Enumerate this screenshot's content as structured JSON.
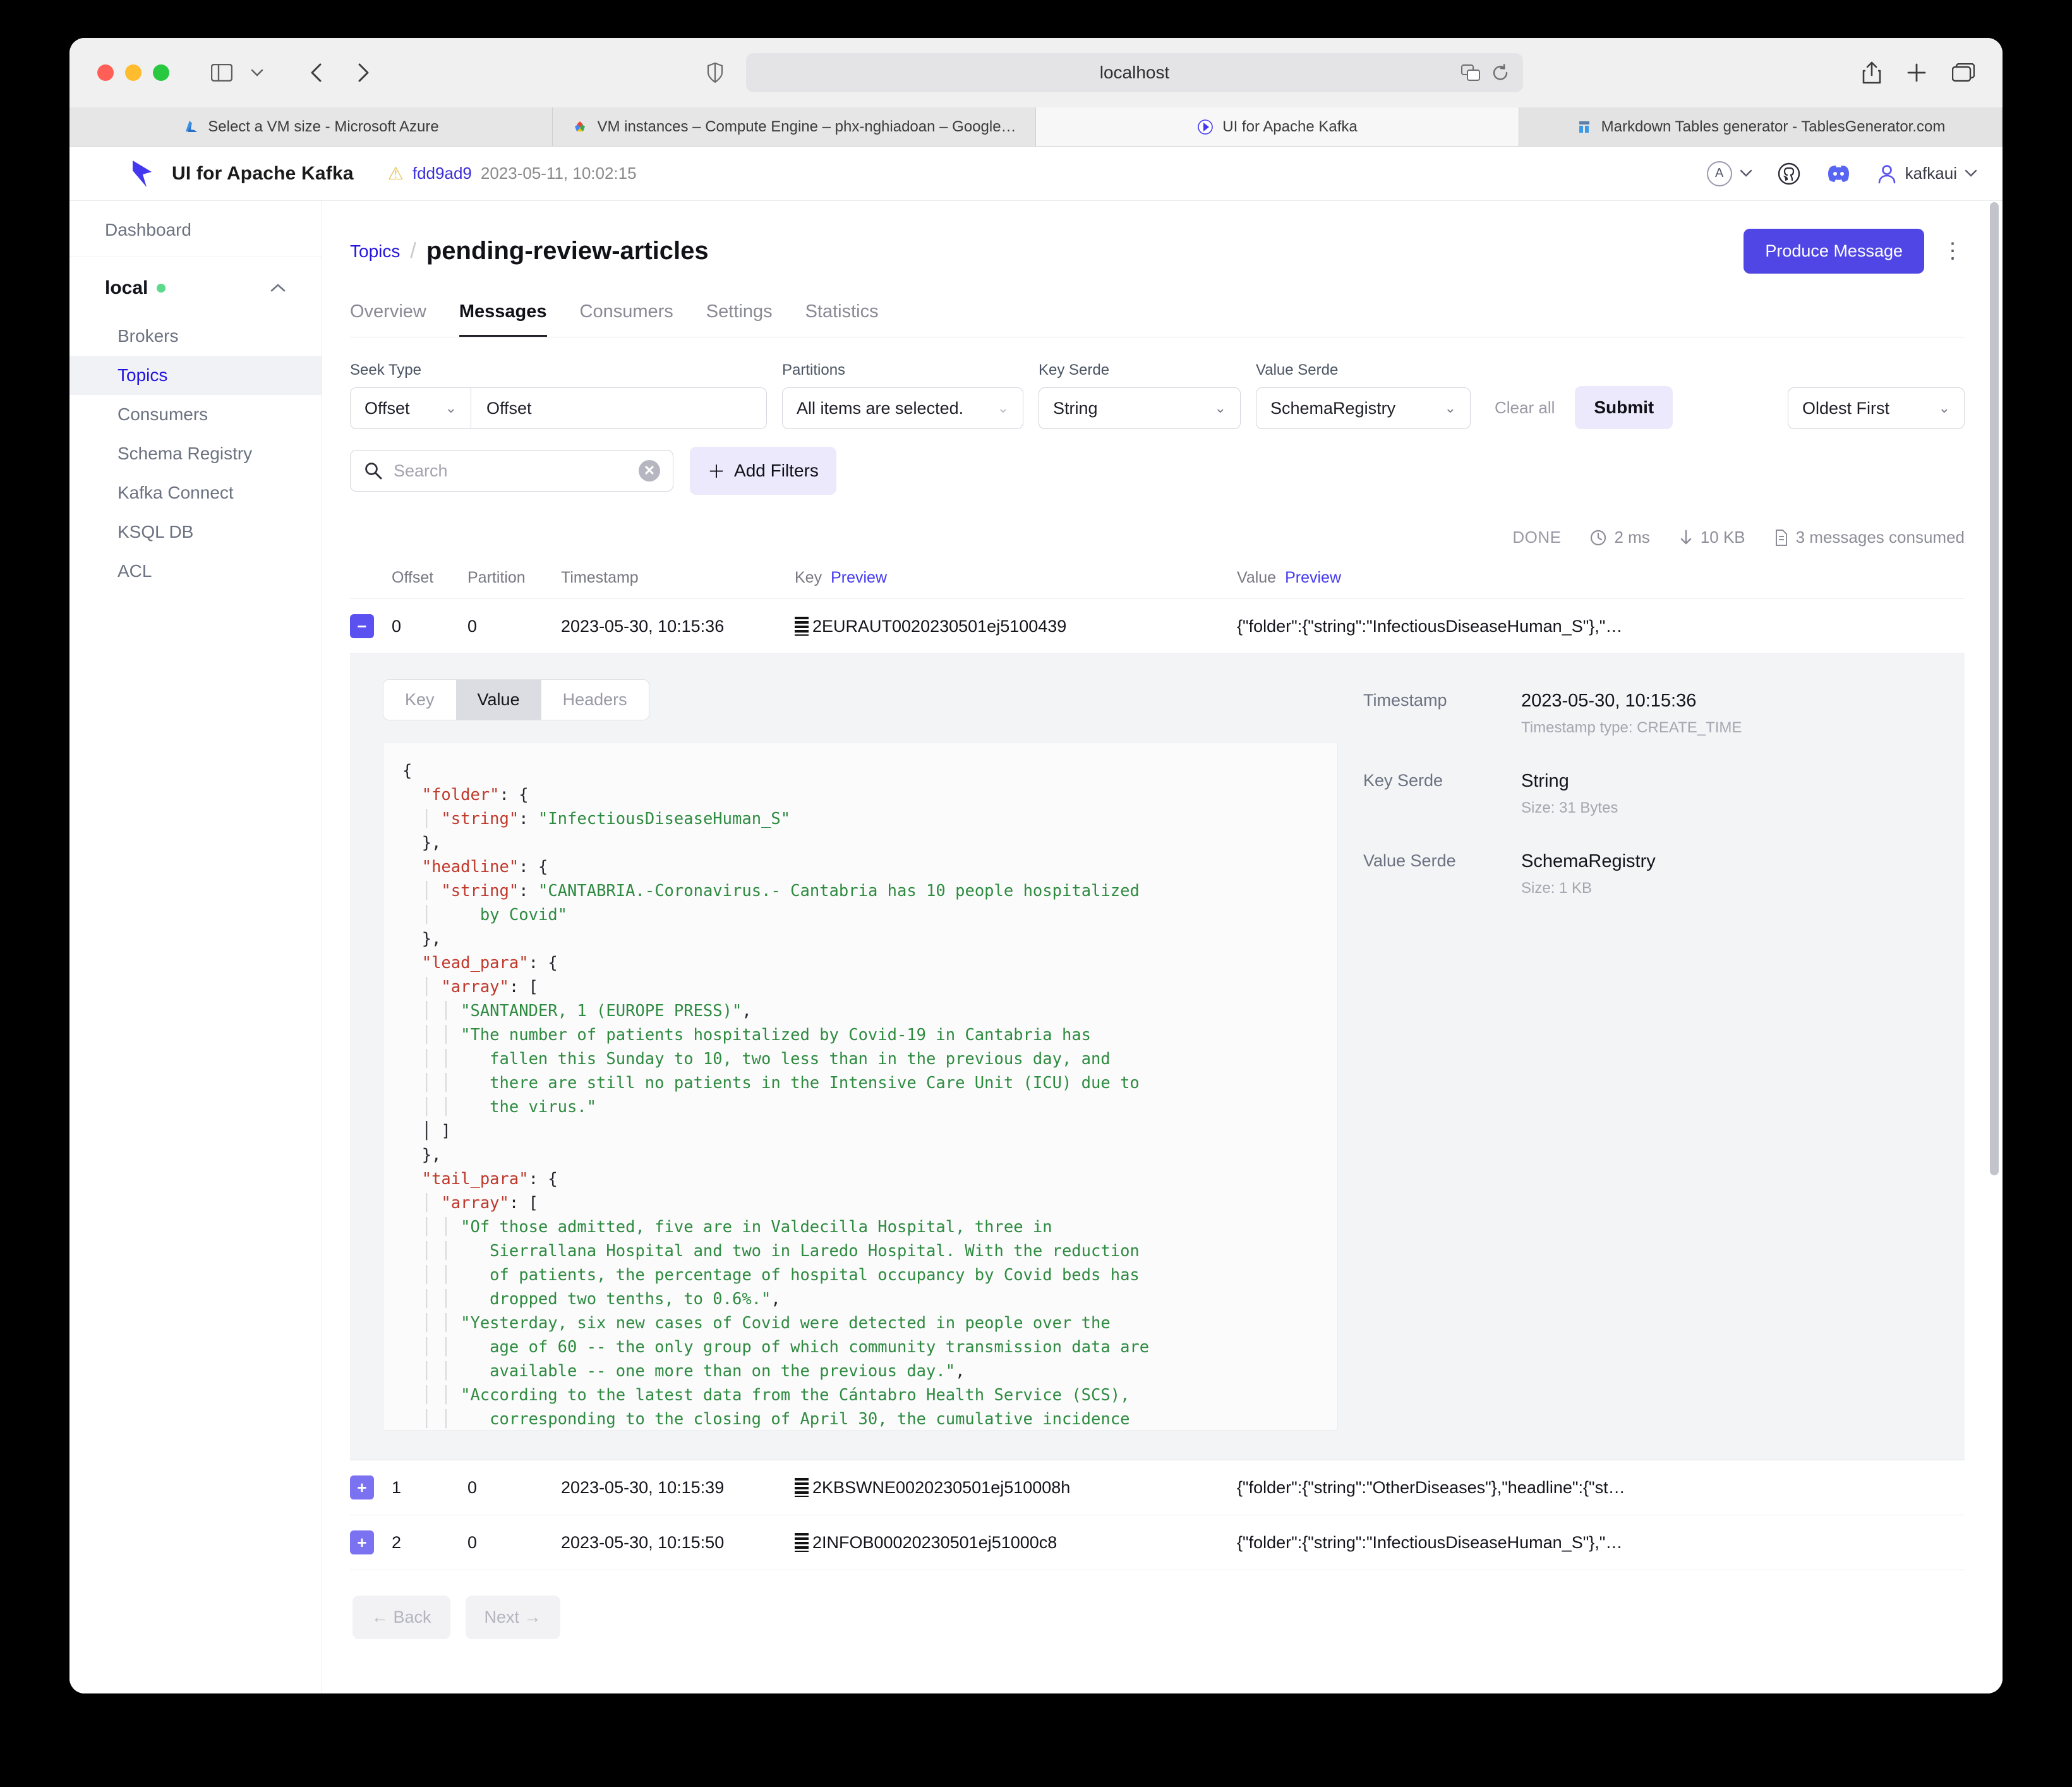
{
  "browser": {
    "url": "localhost",
    "tabs": [
      {
        "label": "Select a VM size - Microsoft Azure",
        "favicon": "azure-icon",
        "state": "inactive"
      },
      {
        "label": "VM instances – Compute Engine – phx-nghiadoan – Google…",
        "favicon": "google-cloud-icon",
        "state": "inactive"
      },
      {
        "label": "UI for Apache Kafka",
        "favicon": "kafka-ui-icon",
        "state": "active"
      },
      {
        "label": "Markdown Tables generator - TablesGenerator.com",
        "favicon": "tablesgenerator-icon",
        "state": "dim"
      }
    ]
  },
  "app_header": {
    "brand": "UI for Apache Kafka",
    "version_hash": "fdd9ad9",
    "version_date": "2023-05-11, 10:02:15",
    "theme_letter": "A",
    "user": "kafkaui"
  },
  "sidebar": {
    "dashboard": "Dashboard",
    "cluster": "local",
    "items": [
      {
        "label": "Brokers",
        "active": false
      },
      {
        "label": "Topics",
        "active": true
      },
      {
        "label": "Consumers",
        "active": false
      },
      {
        "label": "Schema Registry",
        "active": false
      },
      {
        "label": "Kafka Connect",
        "active": false
      },
      {
        "label": "KSQL DB",
        "active": false
      },
      {
        "label": "ACL",
        "active": false
      }
    ]
  },
  "page": {
    "breadcrumb_parent": "Topics",
    "title": "pending-review-articles",
    "produce_button": "Produce Message",
    "tabs": [
      {
        "label": "Overview",
        "selected": false
      },
      {
        "label": "Messages",
        "selected": true
      },
      {
        "label": "Consumers",
        "selected": false
      },
      {
        "label": "Settings",
        "selected": false
      },
      {
        "label": "Statistics",
        "selected": false
      }
    ]
  },
  "filters": {
    "seek_type_label": "Seek Type",
    "seek_type_value": "Offset",
    "seek_offset_value": "Offset",
    "partitions_label": "Partitions",
    "partitions_value": "All items are selected.",
    "key_serde_label": "Key Serde",
    "key_serde_value": "String",
    "value_serde_label": "Value Serde",
    "value_serde_value": "SchemaRegistry",
    "clear_all": "Clear all",
    "submit": "Submit",
    "sort_value": "Oldest First",
    "search_placeholder": "Search",
    "add_filters": "Add Filters"
  },
  "status": {
    "state": "DONE",
    "elapsed": "2 ms",
    "bytes": "10 KB",
    "messages": "3 messages consumed"
  },
  "table": {
    "headers": {
      "offset": "Offset",
      "partition": "Partition",
      "timestamp": "Timestamp",
      "key": "Key",
      "key_preview": "Preview",
      "value": "Value",
      "value_preview": "Preview"
    },
    "rows": [
      {
        "expanded": true,
        "offset": "0",
        "partition": "0",
        "timestamp": "2023-05-30, 10:15:36",
        "key": "2EURAUT0020230501ej5100439",
        "value": "{\"folder\":{\"string\":\"InfectiousDiseaseHuman_S\"},\"…"
      },
      {
        "expanded": false,
        "offset": "1",
        "partition": "0",
        "timestamp": "2023-05-30, 10:15:39",
        "key": "2KBSWNE0020230501ej510008h",
        "value": "{\"folder\":{\"string\":\"OtherDiseases\"},\"headline\":{\"st…"
      },
      {
        "expanded": false,
        "offset": "2",
        "partition": "0",
        "timestamp": "2023-05-30, 10:15:50",
        "key": "2INFOB00020230501ej51000c8",
        "value": "{\"folder\":{\"string\":\"InfectiousDiseaseHuman_S\"},\"…"
      }
    ]
  },
  "detail": {
    "segments": [
      {
        "label": "Key",
        "active": false
      },
      {
        "label": "Value",
        "active": true
      },
      {
        "label": "Headers",
        "active": false
      }
    ],
    "json_lines": [
      [
        {
          "t": "{",
          "c": "jp"
        }
      ],
      [
        {
          "t": "  ",
          "c": "jp"
        },
        {
          "t": "\"folder\"",
          "c": "jk"
        },
        {
          "t": ": {",
          "c": "jp"
        }
      ],
      [
        {
          "t": "  │ ",
          "c": "gut"
        },
        {
          "t": "\"string\"",
          "c": "jk"
        },
        {
          "t": ": ",
          "c": "jp"
        },
        {
          "t": "\"InfectiousDiseaseHuman_S\"",
          "c": "js"
        }
      ],
      [
        {
          "t": "  },",
          "c": "jp"
        }
      ],
      [
        {
          "t": "  ",
          "c": "jp"
        },
        {
          "t": "\"headline\"",
          "c": "jk"
        },
        {
          "t": ": {",
          "c": "jp"
        }
      ],
      [
        {
          "t": "  │ ",
          "c": "gut"
        },
        {
          "t": "\"string\"",
          "c": "jk"
        },
        {
          "t": ": ",
          "c": "jp"
        },
        {
          "t": "\"CANTABRIA.-Coronavirus.- Cantabria has 10 people hospitalized",
          "c": "js"
        }
      ],
      [
        {
          "t": "  │     ",
          "c": "gut"
        },
        {
          "t": "by Covid\"",
          "c": "js"
        }
      ],
      [
        {
          "t": "  },",
          "c": "jp"
        }
      ],
      [
        {
          "t": "  ",
          "c": "jp"
        },
        {
          "t": "\"lead_para\"",
          "c": "jk"
        },
        {
          "t": ": {",
          "c": "jp"
        }
      ],
      [
        {
          "t": "  │ ",
          "c": "gut"
        },
        {
          "t": "\"array\"",
          "c": "jk"
        },
        {
          "t": ": [",
          "c": "jp"
        }
      ],
      [
        {
          "t": "  │ │ ",
          "c": "gut"
        },
        {
          "t": "\"SANTANDER, 1 (EUROPE PRESS)\"",
          "c": "js"
        },
        {
          "t": ",",
          "c": "jp"
        }
      ],
      [
        {
          "t": "  │ │ ",
          "c": "gut"
        },
        {
          "t": "\"The number of patients hospitalized by Covid-19 in Cantabria has",
          "c": "js"
        }
      ],
      [
        {
          "t": "  │ │    ",
          "c": "gut"
        },
        {
          "t": "fallen this Sunday to 10, two less than in the previous day, and",
          "c": "js"
        }
      ],
      [
        {
          "t": "  │ │    ",
          "c": "gut"
        },
        {
          "t": "there are still no patients in the Intensive Care Unit (ICU) due to",
          "c": "js"
        }
      ],
      [
        {
          "t": "  │ │    ",
          "c": "gut"
        },
        {
          "t": "the virus.\"",
          "c": "js"
        }
      ],
      [
        {
          "t": "  │ ]",
          "c": "jp"
        }
      ],
      [
        {
          "t": "  },",
          "c": "jp"
        }
      ],
      [
        {
          "t": "  ",
          "c": "jp"
        },
        {
          "t": "\"tail_para\"",
          "c": "jk"
        },
        {
          "t": ": {",
          "c": "jp"
        }
      ],
      [
        {
          "t": "  │ ",
          "c": "gut"
        },
        {
          "t": "\"array\"",
          "c": "jk"
        },
        {
          "t": ": [",
          "c": "jp"
        }
      ],
      [
        {
          "t": "  │ │ ",
          "c": "gut"
        },
        {
          "t": "\"Of those admitted, five are in Valdecilla Hospital, three in",
          "c": "js"
        }
      ],
      [
        {
          "t": "  │ │    ",
          "c": "gut"
        },
        {
          "t": "Sierrallana Hospital and two in Laredo Hospital. With the reduction",
          "c": "js"
        }
      ],
      [
        {
          "t": "  │ │    ",
          "c": "gut"
        },
        {
          "t": "of patients, the percentage of hospital occupancy by Covid beds has",
          "c": "js"
        }
      ],
      [
        {
          "t": "  │ │    ",
          "c": "gut"
        },
        {
          "t": "dropped two tenths, to 0.6%.\"",
          "c": "js"
        },
        {
          "t": ",",
          "c": "jp"
        }
      ],
      [
        {
          "t": "  │ │ ",
          "c": "gut"
        },
        {
          "t": "\"Yesterday, six new cases of Covid were detected in people over the",
          "c": "js"
        }
      ],
      [
        {
          "t": "  │ │    ",
          "c": "gut"
        },
        {
          "t": "age of 60 -- the only group of which community transmission data are",
          "c": "js"
        }
      ],
      [
        {
          "t": "  │ │    ",
          "c": "gut"
        },
        {
          "t": "available -- one more than on the previous day.\"",
          "c": "js"
        },
        {
          "t": ",",
          "c": "jp"
        }
      ],
      [
        {
          "t": "  │ │ ",
          "c": "gut"
        },
        {
          "t": "\"According to the latest data from the Cántabro Health Service (SCS),",
          "c": "js"
        }
      ],
      [
        {
          "t": "  │ │    ",
          "c": "gut"
        },
        {
          "t": "corresponding to the closing of April 30, the cumulative incidence",
          "c": "js"
        }
      ]
    ],
    "meta": [
      {
        "label": "Timestamp",
        "value": "2023-05-30, 10:15:36",
        "sub": "Timestamp type: CREATE_TIME"
      },
      {
        "label": "Key Serde",
        "value": "String",
        "sub": "Size: 31 Bytes"
      },
      {
        "label": "Value Serde",
        "value": "SchemaRegistry",
        "sub": "Size: 1 KB"
      }
    ]
  },
  "pager": {
    "back": "← Back",
    "next": "Next →"
  }
}
